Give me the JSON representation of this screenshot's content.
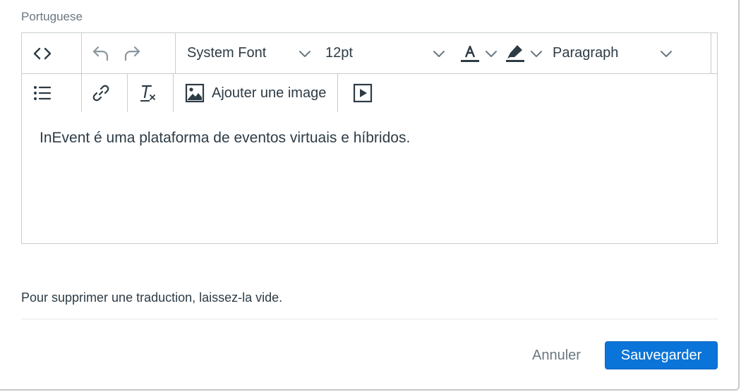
{
  "field": {
    "label": "Portuguese"
  },
  "toolbar": {
    "font_family": "System Font",
    "font_size": "12pt",
    "block_format": "Paragraph",
    "insert_image_label": "Ajouter une image",
    "icons": [
      "code-view-icon",
      "undo-icon",
      "redo-icon",
      "text-color-icon",
      "highlight-color-icon",
      "bullet-list-icon",
      "link-icon",
      "clear-formatting-icon",
      "image-icon",
      "media-icon",
      "chevron-down-icon"
    ]
  },
  "editor": {
    "content": "InEvent é uma plataforma de eventos virtuais e híbridos."
  },
  "hint": "Pour supprimer une traduction, laissez-la vide.",
  "actions": {
    "cancel_label": "Annuler",
    "save_label": "Sauvegarder"
  },
  "colors": {
    "primary": "#0b74d8",
    "text": "#2d3b45",
    "muted": "#6b7780",
    "border": "#c7cdd1"
  }
}
